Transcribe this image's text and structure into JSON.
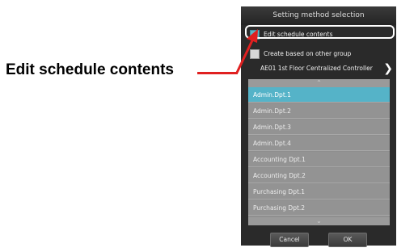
{
  "callout": {
    "label": "Edit schedule contents"
  },
  "dialog": {
    "title": "Setting method selection",
    "options": [
      {
        "label": "Edit schedule contents",
        "checked": true
      },
      {
        "label": "Create based on other group",
        "checked": false
      }
    ],
    "controller": {
      "label": "AE01 1st Floor Centralized Controller"
    },
    "groups": [
      {
        "label": "Admin.Dpt.1",
        "selected": true
      },
      {
        "label": "Admin.Dpt.2",
        "selected": false
      },
      {
        "label": "Admin.Dpt.3",
        "selected": false
      },
      {
        "label": "Admin.Dpt.4",
        "selected": false
      },
      {
        "label": "Accounting Dpt.1",
        "selected": false
      },
      {
        "label": "Accounting Dpt.2",
        "selected": false
      },
      {
        "label": "Purchasing Dpt.1",
        "selected": false
      },
      {
        "label": "Purchasing Dpt.2",
        "selected": false
      }
    ],
    "buttons": {
      "cancel": "Cancel",
      "ok": "OK"
    }
  },
  "icons": {
    "controller_nav": "chevron-right-icon",
    "scroll_up": "chevron-up-icon",
    "scroll_down": "chevron-down-icon"
  },
  "colors": {
    "callout": "#e02020",
    "selected_item": "#55b3c8",
    "checkbox_on": "#5fb3c3"
  }
}
